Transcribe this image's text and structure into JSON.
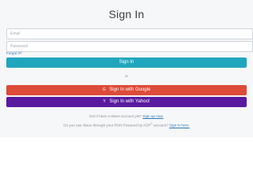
{
  "page": {
    "title": "Sign In"
  },
  "form": {
    "email_placeholder": "Email",
    "password_placeholder": "Password",
    "forgot_link": "Forgot it?",
    "signin_button": "Sign In"
  },
  "divider": {
    "text": "or"
  },
  "social": {
    "google_icon": "google-logo",
    "google_button": "Sign In with Google",
    "yahoo_icon": "yahoo-logo",
    "yahoo_button": "Sign In with Yahoo!"
  },
  "footer": {
    "no_account_text": "Don't have a Wave account yet?",
    "signup_link": "Sign up now.",
    "payroll_text_prefix": "Do you use Wave through your RUN Powered by ADP",
    "registered_mark": "®",
    "payroll_text_suffix": "account?",
    "signin_here_link": "Sign in here."
  },
  "colors": {
    "primary": "#20a6bc",
    "google": "#dd4b39",
    "yahoo": "#5a1aa0",
    "link": "#2f78b5"
  }
}
